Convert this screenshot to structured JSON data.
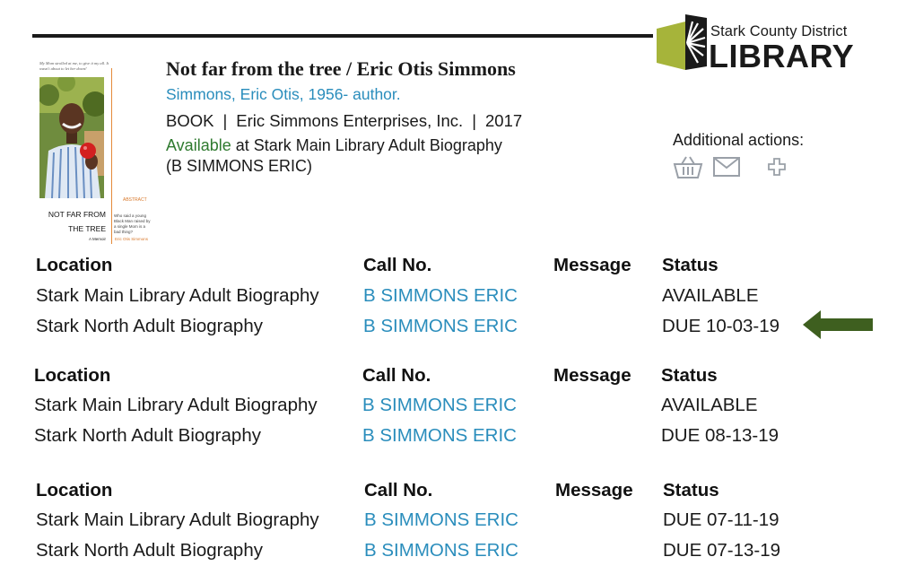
{
  "logo": {
    "line1": "Stark County District",
    "line2": "LIBRARY",
    "colors": {
      "green": "#a6b43a",
      "dark": "#1a1a1a"
    }
  },
  "cover": {
    "tagline": "My Mom strolled at me, to give it my all. It wasn't about to let her down!",
    "abstract_label": "ABSTRACT",
    "blurb": "Who said a young Black Man raised by a single Mom is a bad thing?",
    "title_line1": "NOT FAR FROM",
    "title_line2": "THE TREE",
    "subtitle": "A Memoir",
    "author": "Eric Otis Simmons"
  },
  "record": {
    "title": "Not far from the tree",
    "title_sep": " / ",
    "title_author": "Eric Otis Simmons",
    "author_link": "Simmons, Eric Otis, 1956- author.",
    "format": "BOOK",
    "publisher": "Eric Simmons Enterprises, Inc.",
    "year": "2017",
    "separator": "|",
    "availability": "Available",
    "availability_rest": " at Stark Main Library Adult Biography",
    "call_number_paren": "(B SIMMONS ERIC)"
  },
  "actions": {
    "label": "Additional actions:",
    "icons": [
      "basket-icon",
      "mail-icon",
      "plus-icon"
    ]
  },
  "holdings_headers": {
    "location": "Location",
    "call_no": "Call No.",
    "message": "Message",
    "status": "Status"
  },
  "holdings": [
    {
      "rows": [
        {
          "location": "Stark Main Library Adult Biography",
          "call_no": "B SIMMONS ERIC",
          "message": "",
          "status": "AVAILABLE"
        },
        {
          "location": "Stark North Adult Biography",
          "call_no": "B SIMMONS ERIC",
          "message": "",
          "status": "DUE 10-03-19"
        }
      ]
    },
    {
      "rows": [
        {
          "location": "Stark Main Library Adult Biography",
          "call_no": "B SIMMONS ERIC",
          "message": "",
          "status": "AVAILABLE"
        },
        {
          "location": "Stark North Adult Biography",
          "call_no": "B SIMMONS ERIC",
          "message": "",
          "status": "DUE 08-13-19"
        }
      ]
    },
    {
      "rows": [
        {
          "location": "Stark Main Library Adult Biography",
          "call_no": "B SIMMONS ERIC",
          "message": "",
          "status": "DUE 07-11-19"
        },
        {
          "location": "Stark North Adult Biography",
          "call_no": "B SIMMONS ERIC",
          "message": "",
          "status": "DUE 07-13-19"
        }
      ]
    }
  ],
  "annotation": {
    "arrow_color": "#3e5f1f"
  }
}
